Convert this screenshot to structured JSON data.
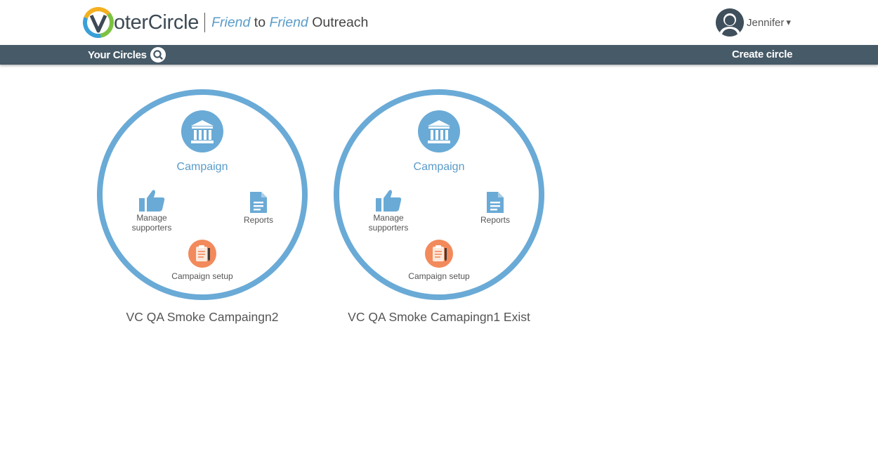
{
  "brand": {
    "name_rest": "oterCircle",
    "tagline": {
      "word1": "Friend",
      "word2": "to",
      "word3": "Friend",
      "word4": "Outreach"
    }
  },
  "user": {
    "name": "Jennifer",
    "caret": "▾"
  },
  "navbar": {
    "title": "Your Circles",
    "create_label": "Create circle",
    "color": "#465a68"
  },
  "circles": [
    {
      "category": "Campaign",
      "manage_label_line1": "Manage",
      "manage_label_line2": "supporters",
      "reports_label": "Reports",
      "setup_label": "Campaign setup",
      "title": "VC QA Smoke Campaingn2"
    },
    {
      "category": "Campaign",
      "manage_label_line1": "Manage",
      "manage_label_line2": "supporters",
      "reports_label": "Reports",
      "setup_label": "Campaign setup",
      "title": "VC QA Smoke Camapingn1 Exist"
    }
  ],
  "colors": {
    "ring": "#6aaad6",
    "setup": "#f28a5b",
    "accent_text": "#5a9cc8"
  },
  "icons": {
    "bank": "bank-icon",
    "thumbs_up": "thumbs-up-icon",
    "document": "document-icon",
    "clipboard": "clipboard-icon",
    "search": "search-icon",
    "avatar": "user-avatar-icon"
  }
}
